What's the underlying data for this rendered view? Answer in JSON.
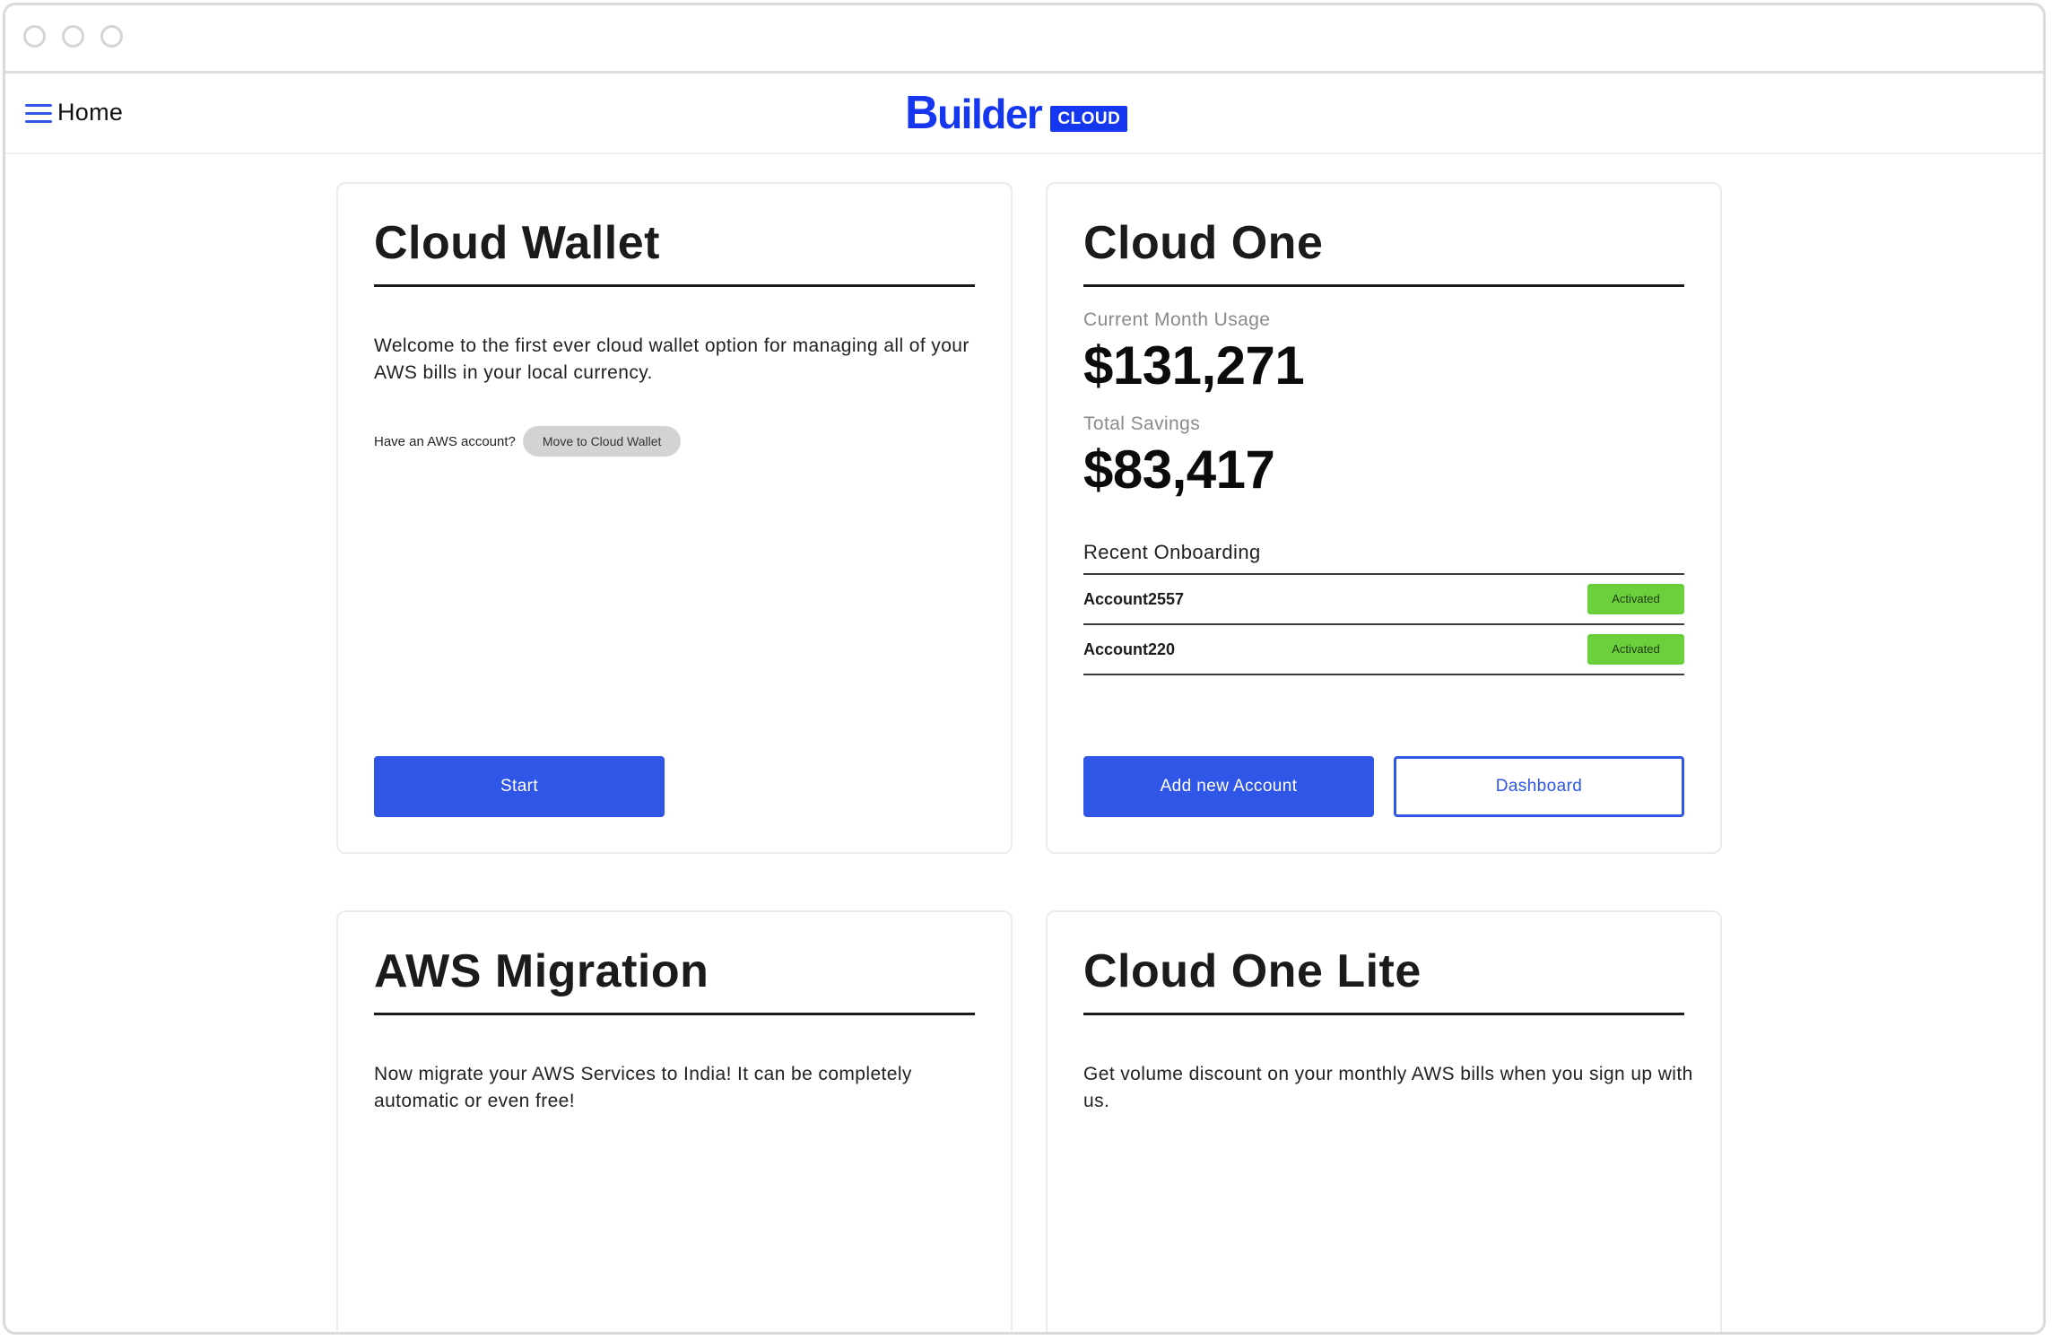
{
  "navbar": {
    "home_label": "Home",
    "logo_text_first": "B",
    "logo_text_rest": "uilder",
    "logo_badge": "CLOUD",
    "brand_color": "#1437EF"
  },
  "cloud_wallet": {
    "title": "Cloud Wallet",
    "description": "Welcome to the first ever cloud wallet option for managing all of your AWS bills in your local currency.",
    "aws_question": "Have an AWS account?",
    "move_button": "Move to Cloud Wallet",
    "start_button": "Start"
  },
  "cloud_one": {
    "title": "Cloud One",
    "usage_label": "Current Month Usage",
    "usage_value": "$131,271",
    "savings_label": "Total Savings",
    "savings_value": "$83,417",
    "onboarding_label": "Recent Onboarding",
    "accounts": [
      {
        "name": "Account2557",
        "status": "Activated"
      },
      {
        "name": "Account220",
        "status": "Activated"
      }
    ],
    "add_button": "Add new Account",
    "dashboard_button": "Dashboard"
  },
  "aws_migration": {
    "title": "AWS Migration",
    "description": "Now migrate your AWS Services to India! It can be completely automatic or even free!"
  },
  "cloud_one_lite": {
    "title": "Cloud One Lite",
    "description": "Get volume discount on your monthly AWS bills when you sign up with us."
  },
  "colors": {
    "primary_button": "#3056E8",
    "status_activated": "#6CD03C"
  }
}
